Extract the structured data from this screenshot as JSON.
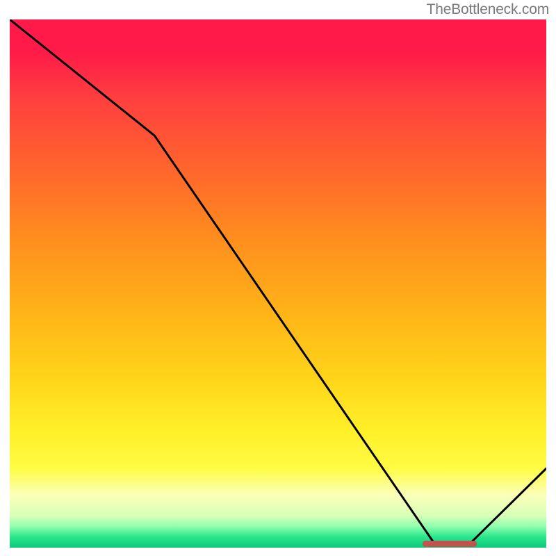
{
  "watermark": "TheBottleneck.com",
  "chart_data": {
    "type": "line",
    "title": "",
    "xlabel": "",
    "ylabel": "",
    "xlim": [
      0,
      100
    ],
    "ylim": [
      0,
      100
    ],
    "series": [
      {
        "name": "curve",
        "x": [
          0,
          27,
          79,
          86,
          100
        ],
        "values": [
          100,
          78,
          1.0,
          1.0,
          15
        ]
      }
    ],
    "annotations": [
      {
        "name": "optimal-range-marker",
        "x_start": 77,
        "x_end": 87,
        "y": 0.8
      }
    ],
    "grid": false,
    "legend": false
  },
  "colors": {
    "curve": "#000000",
    "marker": "#c25450",
    "gradient_top": "#ff1a49",
    "gradient_bottom": "#0dc97a"
  }
}
